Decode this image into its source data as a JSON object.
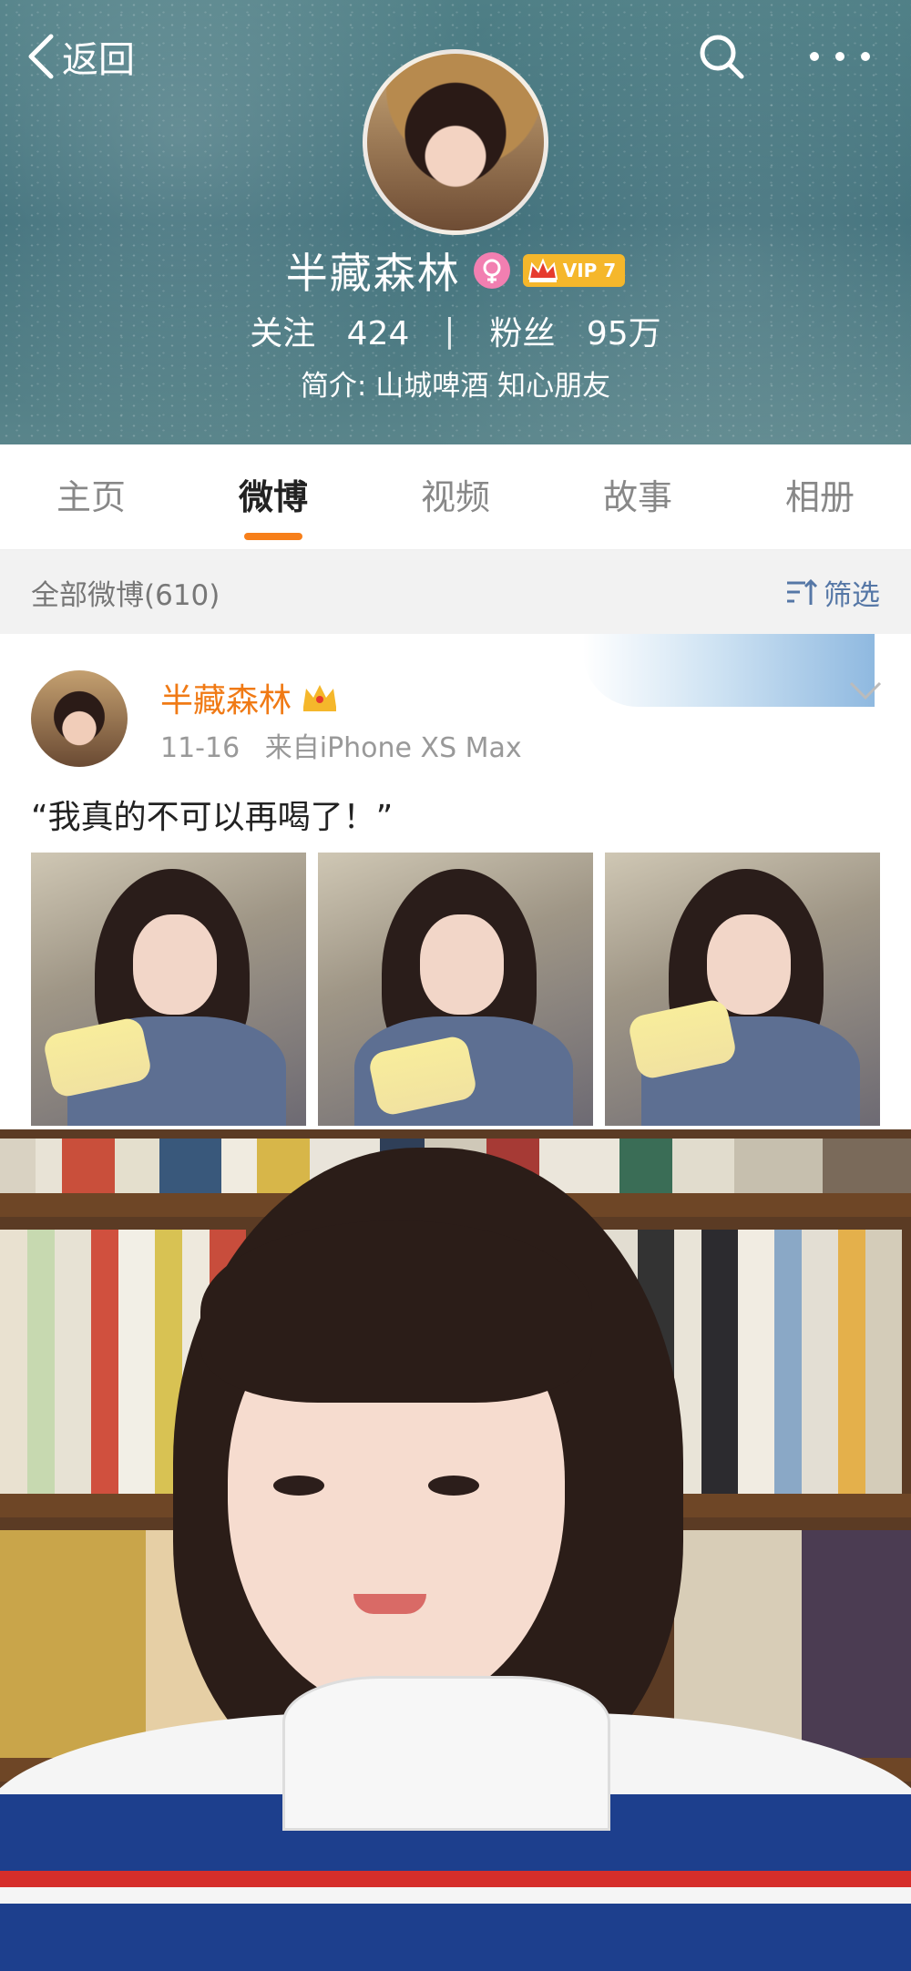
{
  "nav": {
    "back_label": "返回",
    "back_icon": "chevron-left-icon",
    "search_icon": "search-icon",
    "more_icon": "more-icon"
  },
  "profile": {
    "name": "半藏森林",
    "vip_label": "VIP 7",
    "follow_label": "关注",
    "follow_count": "424",
    "separator": "|",
    "fans_label": "粉丝",
    "fans_count": "95万",
    "intro": "简介: 山城啤酒 知心朋友"
  },
  "tabs": [
    {
      "label": "主页",
      "active": false
    },
    {
      "label": "微博",
      "active": true
    },
    {
      "label": "视频",
      "active": false
    },
    {
      "label": "故事",
      "active": false
    },
    {
      "label": "相册",
      "active": false
    }
  ],
  "filter": {
    "count_label": "全部微博(610)",
    "filter_label": "筛选"
  },
  "post": {
    "author": "半藏森林",
    "date": "11-16",
    "source": "来自iPhone XS Max",
    "text": "“我真的不可以再喝了！”",
    "photo_count": 3
  },
  "colors": {
    "accent": "#f77f1a",
    "author_orange": "#f07a15",
    "link_blue": "#5577a6",
    "vip_gold": "#f5b72b",
    "female_pink": "#f27fb1"
  }
}
